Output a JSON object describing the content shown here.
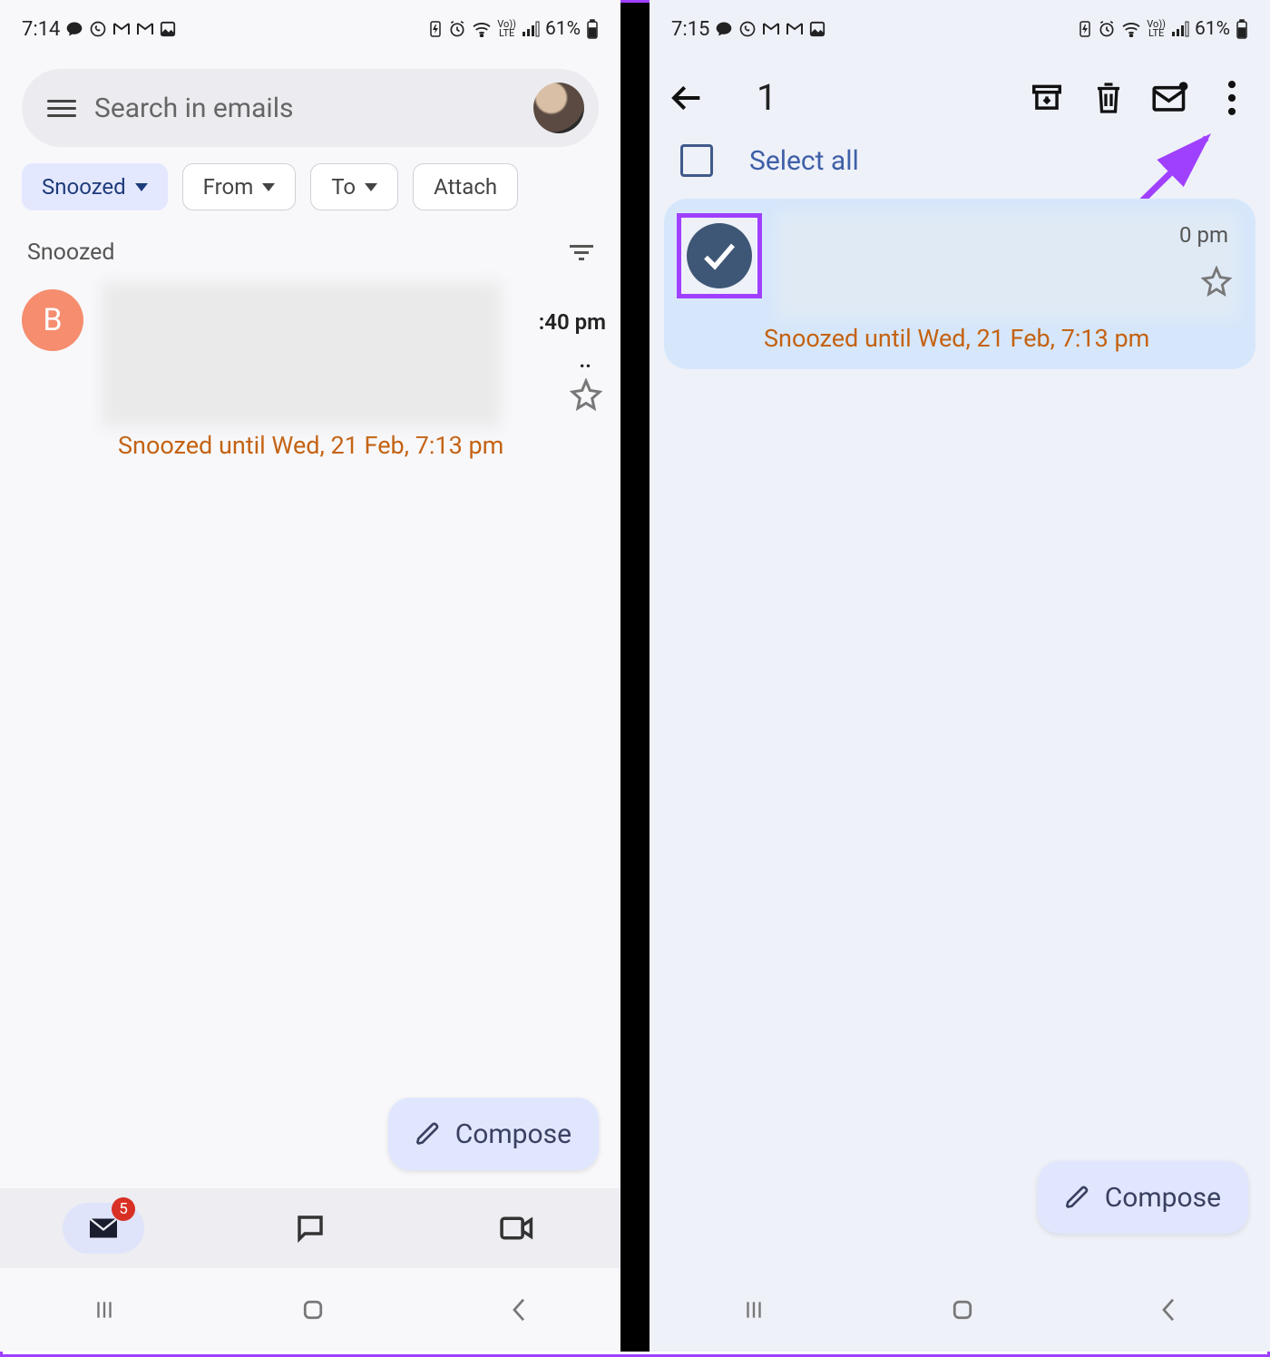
{
  "status": {
    "left_time": "7:14",
    "right_time": "7:15",
    "battery_pct": "61%",
    "net_label": "Vo)) LTE"
  },
  "search": {
    "placeholder": "Search in emails"
  },
  "chips": {
    "snoozed": "Snoozed",
    "from": "From",
    "to": "To",
    "attach": "Attach"
  },
  "section": {
    "label": "Snoozed"
  },
  "email": {
    "avatar_letter": "B",
    "time": ":40 pm",
    "dots": "..",
    "snoozed_until": "Snoozed until Wed, 21 Feb, 7:13 pm"
  },
  "compose": {
    "label": "Compose"
  },
  "bottom_nav": {
    "mail_badge": "5"
  },
  "right_screen": {
    "selected_count": "1",
    "select_all": "Select all",
    "time_partial": "0 pm",
    "snoozed_until": "Snoozed until Wed, 21 Feb, 7:13 pm"
  }
}
